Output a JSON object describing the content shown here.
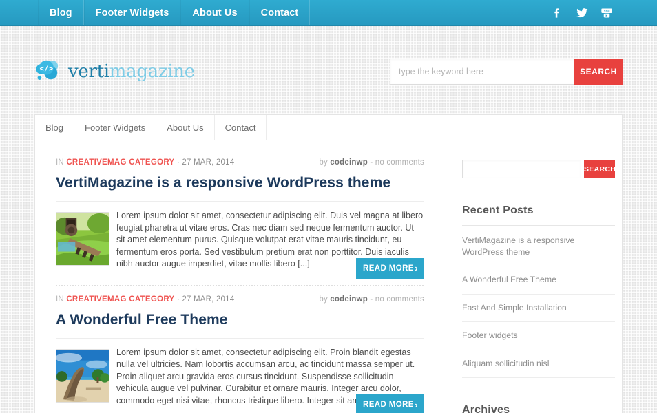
{
  "topbar": {
    "nav": [
      {
        "label": "Blog"
      },
      {
        "label": "Footer Widgets"
      },
      {
        "label": "About Us"
      },
      {
        "label": "Contact"
      }
    ],
    "social": [
      {
        "name": "facebook-icon",
        "label": "Facebook"
      },
      {
        "name": "twitter-icon",
        "label": "Twitter"
      },
      {
        "name": "youtube-icon",
        "label": "YouTube"
      }
    ],
    "bg_color": "#2ba6cb"
  },
  "header": {
    "logo": {
      "text_primary": "verti",
      "text_secondary": "magazine",
      "mark": "code-bubble-icon"
    },
    "search": {
      "placeholder": "type the keyword here",
      "value": "",
      "button_label": "SEARCH",
      "button_color": "#e8413e"
    }
  },
  "subnav": {
    "items": [
      {
        "label": "Blog"
      },
      {
        "label": "Footer Widgets"
      },
      {
        "label": "About Us"
      },
      {
        "label": "Contact"
      }
    ]
  },
  "main": {
    "posts": [
      {
        "meta_in": "IN",
        "category": "CREATIVEMAG CATEGORY",
        "separator": "·",
        "date": "27 MAR, 2014",
        "author_prefix": "by",
        "author": "codeinwp",
        "comments": "- no comments",
        "title": "VertiMagazine is a responsive WordPress theme",
        "excerpt": "Lorem ipsum dolor sit amet, consectetur adipiscing elit. Duis vel magna at libero feugiat pharetra ut vitae eros. Cras nec diam sed neque fermentum auctor. Ut sit amet elementum purus. Quisque volutpat erat vitae mauris tincidunt, eu fermentum eros porta. Sed vestibulum pretium erat non porttitor. Duis iaculis nibh auctor augue imperdiet, vitae mollis libero [...]",
        "read_more": "READ MORE",
        "chevron": "›",
        "thumb": "watermill-garden-photo"
      },
      {
        "meta_in": "IN",
        "category": "CREATIVEMAG CATEGORY",
        "separator": "·",
        "date": "27 MAR, 2014",
        "author_prefix": "by",
        "author": "codeinwp",
        "comments": "- no comments",
        "title": "A Wonderful Free Theme",
        "excerpt": "Lorem ipsum dolor sit amet, consectetur adipiscing elit. Proin blandit egestas nulla vel ultricies. Nam lobortis accumsan arcu, ac tincidunt massa semper ut. Proin aliquet arcu gravida eros cursus tincidunt. Suspendisse sollicitudin vehicula augue vel pulvinar. Curabitur et ornare mauris. Integer arcu dolor, commodo eget nisi vitae, rhoncus tristique libero. Integer sit amet est quis [...]",
        "read_more": "READ MORE",
        "chevron": "›",
        "thumb": "beach-canoe-photo"
      }
    ]
  },
  "sidebar": {
    "search": {
      "placeholder": "",
      "value": "",
      "button_label": "SEARCH"
    },
    "recent_posts_title": "Recent Posts",
    "recent_posts": [
      {
        "label": "VertiMagazine is a responsive WordPress theme"
      },
      {
        "label": "A Wonderful Free Theme"
      },
      {
        "label": "Fast And Simple Installation"
      },
      {
        "label": "Footer widgets"
      },
      {
        "label": "Aliquam sollicitudin nisl"
      }
    ],
    "archives_title": "Archives"
  }
}
